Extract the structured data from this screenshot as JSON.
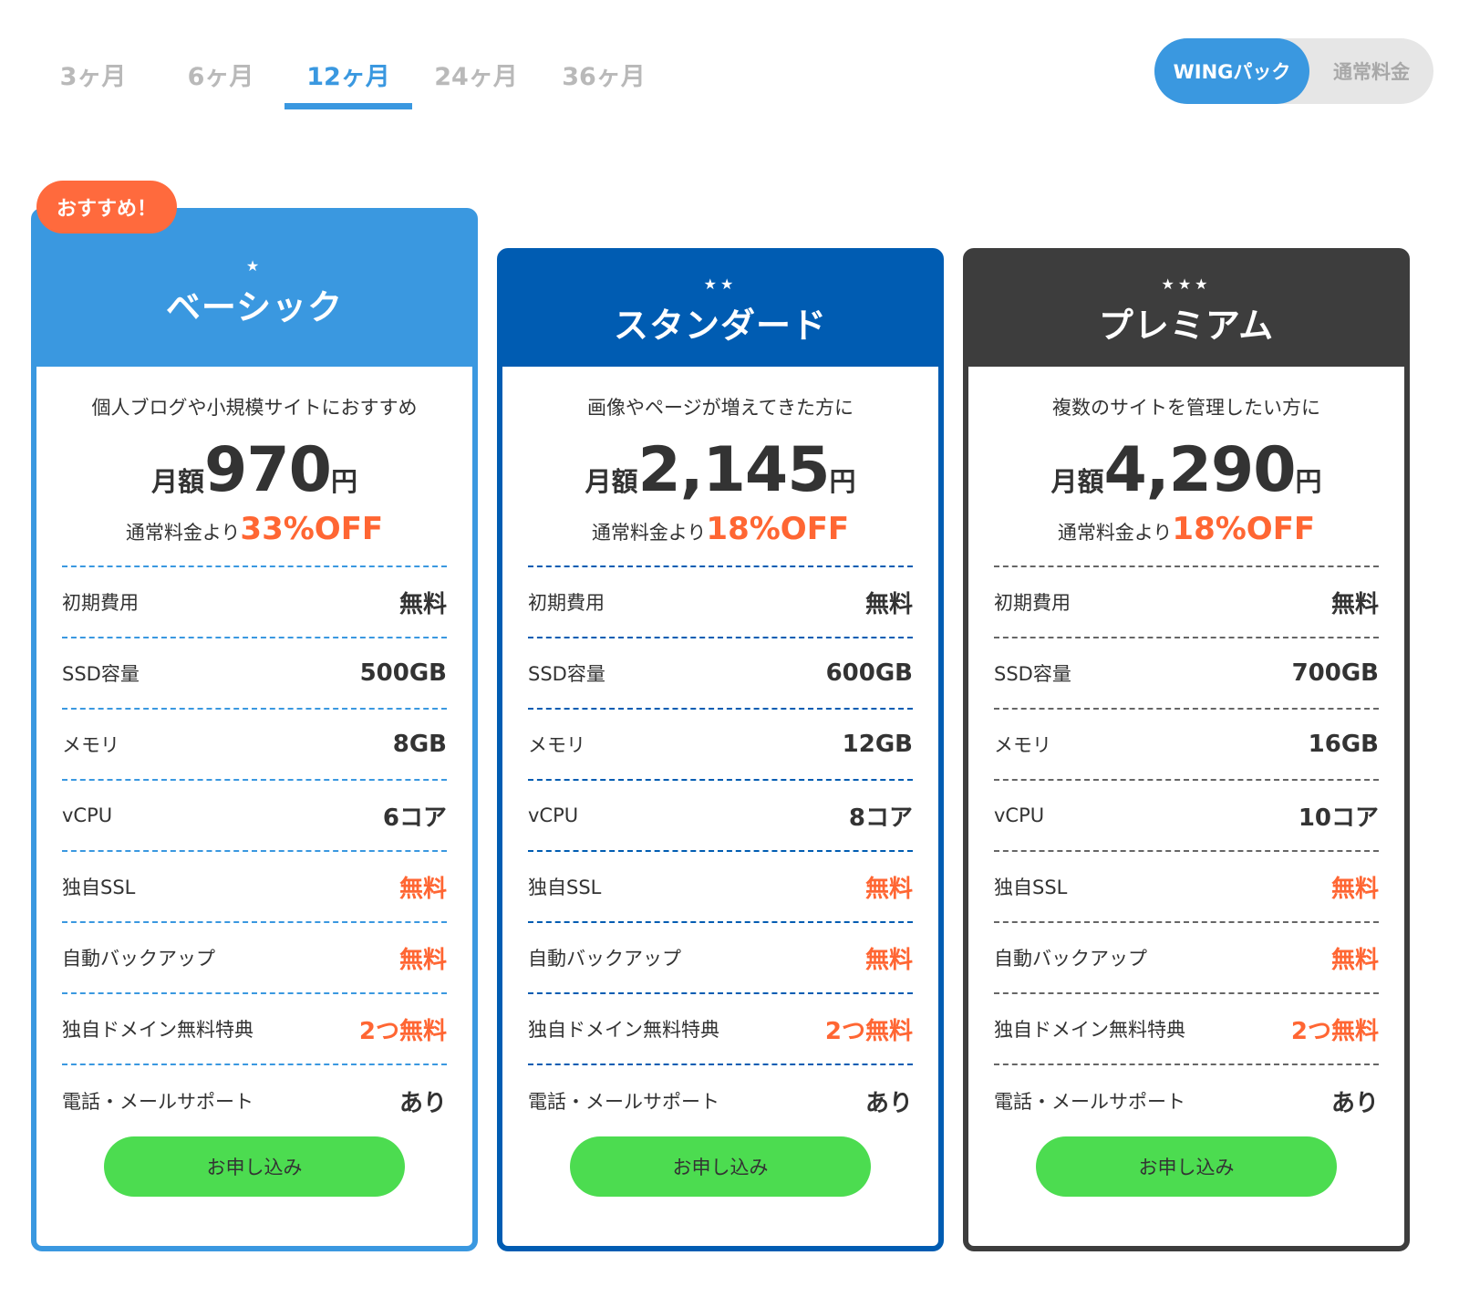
{
  "tabs": [
    {
      "label": "3ヶ月"
    },
    {
      "label": "6ヶ月"
    },
    {
      "label": "12ヶ月"
    },
    {
      "label": "24ヶ月"
    },
    {
      "label": "36ヶ月"
    }
  ],
  "active_tab": "12ヶ月",
  "toggle": {
    "on_label": "WINGパック",
    "off_label": "通常料金"
  },
  "badge": "おすすめ！",
  "colors": {
    "accent": "#3a98e0",
    "standard": "#005cb2",
    "premium": "#3d3d3d",
    "discount": "#ff6633",
    "apply_button": "#4cdc50"
  },
  "plans": [
    {
      "stars": "★",
      "name": "ベーシック",
      "tagline": "個人ブログや小規模サイトにおすすめ",
      "price_prefix": "月額",
      "price": "970",
      "price_suffix": "円",
      "discount_prefix": "通常料金より",
      "discount": "33%OFF",
      "features": [
        {
          "label": "初期費用",
          "value": "無料"
        },
        {
          "label": "SSD容量",
          "value": "500GB"
        },
        {
          "label": "メモリ",
          "value": "8GB"
        },
        {
          "label": "vCPU",
          "value": "6コア"
        },
        {
          "label": "独自SSL",
          "value": "無料"
        },
        {
          "label": "自動バックアップ",
          "value": "無料"
        },
        {
          "label": "独自ドメイン無料特典",
          "value": "2つ無料"
        },
        {
          "label": "電話・メールサポート",
          "value": "あり"
        }
      ],
      "apply_label": "お申し込み"
    },
    {
      "stars": "★★",
      "name": "スタンダード",
      "tagline": "画像やページが増えてきた方に",
      "price_prefix": "月額",
      "price": "2,145",
      "price_suffix": "円",
      "discount_prefix": "通常料金より",
      "discount": "18%OFF",
      "features": [
        {
          "label": "初期費用",
          "value": "無料"
        },
        {
          "label": "SSD容量",
          "value": "600GB"
        },
        {
          "label": "メモリ",
          "value": "12GB"
        },
        {
          "label": "vCPU",
          "value": "8コア"
        },
        {
          "label": "独自SSL",
          "value": "無料"
        },
        {
          "label": "自動バックアップ",
          "value": "無料"
        },
        {
          "label": "独自ドメイン無料特典",
          "value": "2つ無料"
        },
        {
          "label": "電話・メールサポート",
          "value": "あり"
        }
      ],
      "apply_label": "お申し込み"
    },
    {
      "stars": "★★★",
      "name": "プレミアム",
      "tagline": "複数のサイトを管理したい方に",
      "price_prefix": "月額",
      "price": "4,290",
      "price_suffix": "円",
      "discount_prefix": "通常料金より",
      "discount": "18%OFF",
      "features": [
        {
          "label": "初期費用",
          "value": "無料"
        },
        {
          "label": "SSD容量",
          "value": "700GB"
        },
        {
          "label": "メモリ",
          "value": "16GB"
        },
        {
          "label": "vCPU",
          "value": "10コア"
        },
        {
          "label": "独自SSL",
          "value": "無料"
        },
        {
          "label": "自動バックアップ",
          "value": "無料"
        },
        {
          "label": "独自ドメイン無料特典",
          "value": "2つ無料"
        },
        {
          "label": "電話・メールサポート",
          "value": "あり"
        }
      ],
      "apply_label": "お申し込み"
    }
  ]
}
